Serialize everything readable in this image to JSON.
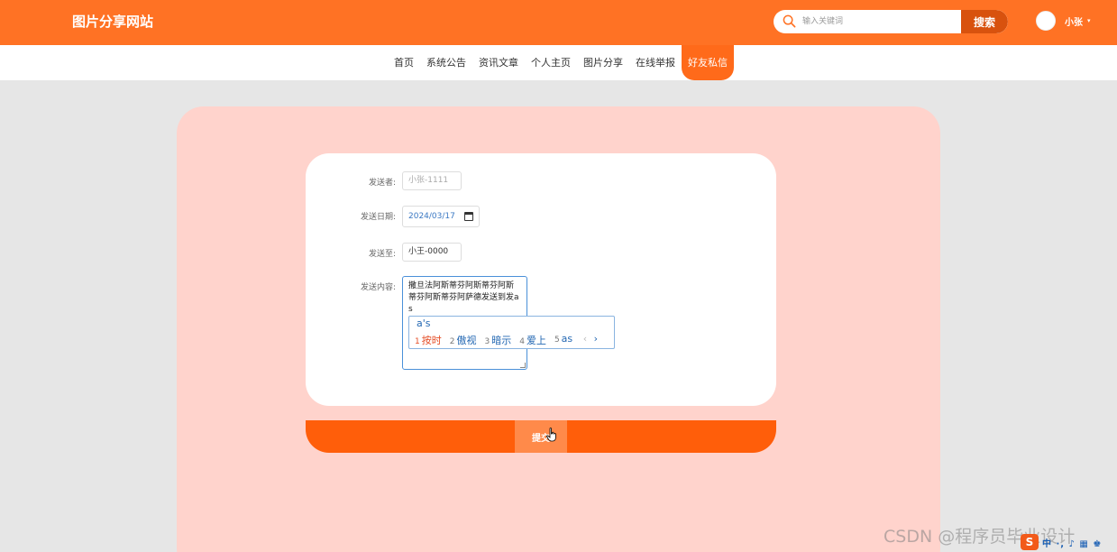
{
  "header": {
    "site_title": "图片分享网站",
    "search_placeholder": "输入关键词",
    "search_button": "搜索",
    "user_name": "小张",
    "caret": "▾"
  },
  "nav": {
    "items": [
      {
        "label": "首页",
        "active": false
      },
      {
        "label": "系统公告",
        "active": false
      },
      {
        "label": "资讯文章",
        "active": false
      },
      {
        "label": "个人主页",
        "active": false
      },
      {
        "label": "图片分享",
        "active": false
      },
      {
        "label": "在线举报",
        "active": false
      },
      {
        "label": "好友私信",
        "active": true
      }
    ]
  },
  "form": {
    "sender_label": "发送者:",
    "sender_value": "小张-1111",
    "date_label": "发送日期:",
    "date_value": "2024/03/17",
    "to_label": "发送至:",
    "to_value": "小王-0000",
    "content_label": "发送内容:",
    "content_value": "撒旦法阿斯蒂芬阿斯蒂芬阿斯蒂芬阿斯蒂芬阿萨德发送到发as",
    "submit_label": "提交"
  },
  "ime": {
    "composition": "a's",
    "candidates": [
      {
        "num": "1",
        "text": "按时"
      },
      {
        "num": "2",
        "text": "傲视"
      },
      {
        "num": "3",
        "text": "暗示"
      },
      {
        "num": "4",
        "text": "爱上"
      },
      {
        "num": "5",
        "text": "as"
      }
    ],
    "prev": "‹",
    "next": "›"
  },
  "watermark": "CSDN @程序员毕业设计",
  "ime_toolbar": {
    "logo": "S",
    "text": "中 ·, ♪ ▦ ♚"
  },
  "colors": {
    "primary": "#ff7224",
    "submit_bar": "#ff5e0a",
    "card_bg": "#ffd3cc",
    "page_bg": "#e6e6e6"
  }
}
